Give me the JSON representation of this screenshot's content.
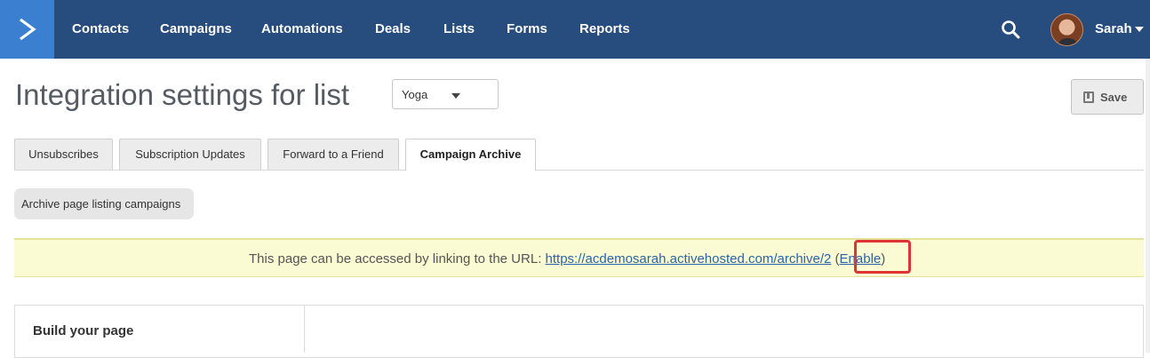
{
  "nav": {
    "items": [
      {
        "label": "Contacts"
      },
      {
        "label": "Campaigns"
      },
      {
        "label": "Automations"
      },
      {
        "label": "Deals"
      },
      {
        "label": "Lists"
      },
      {
        "label": "Forms"
      },
      {
        "label": "Reports"
      }
    ],
    "user_name": "Sarah",
    "logo_icon": "activecampaign-chevron-icon",
    "search_icon": "search-icon"
  },
  "page": {
    "title": "Integration settings for list",
    "list_select_value": "Yoga",
    "save_label": "Save"
  },
  "tabs": [
    {
      "label": "Unsubscribes",
      "active": false
    },
    {
      "label": "Subscription Updates",
      "active": false
    },
    {
      "label": "Forward to a Friend",
      "active": false
    },
    {
      "label": "Campaign Archive",
      "active": true
    }
  ],
  "subtab": {
    "label": "Archive page listing campaigns"
  },
  "notice": {
    "text": "This page can be accessed by linking to the URL: ",
    "url": "https://acdemosarah.activehosted.com/archive/2",
    "open_paren": " (",
    "enable_label": "Enable",
    "close_paren": ")"
  },
  "panel": {
    "title": "Build your page"
  },
  "colors": {
    "nav_bg": "#264d7e",
    "logo_bg": "#3a7fd0",
    "notice_bg": "#fbfbd3",
    "highlight": "#e03334",
    "link": "#2a64a8"
  }
}
